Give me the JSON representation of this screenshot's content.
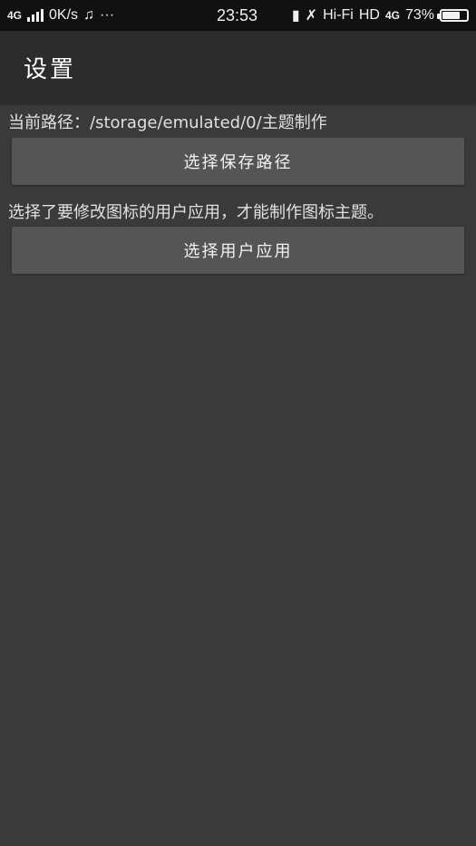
{
  "status_bar": {
    "left": {
      "network": "4G",
      "speed": "0K/s",
      "music_icon": "music-note-icon",
      "more": "···"
    },
    "time": "23:53",
    "right": {
      "hifi": "Hi-Fi",
      "hd": "HD",
      "network2": "4G",
      "battery_percent": "73%",
      "battery_level": 0.73
    }
  },
  "app_bar": {
    "title": "设置"
  },
  "settings": {
    "path_label": "当前路径：/storage/emulated/0/主题制作",
    "save_path_button": "选择保存路径",
    "app_hint": "选择了要修改图标的用户应用，才能制作图标主题。",
    "select_app_button": "选择用户应用"
  }
}
